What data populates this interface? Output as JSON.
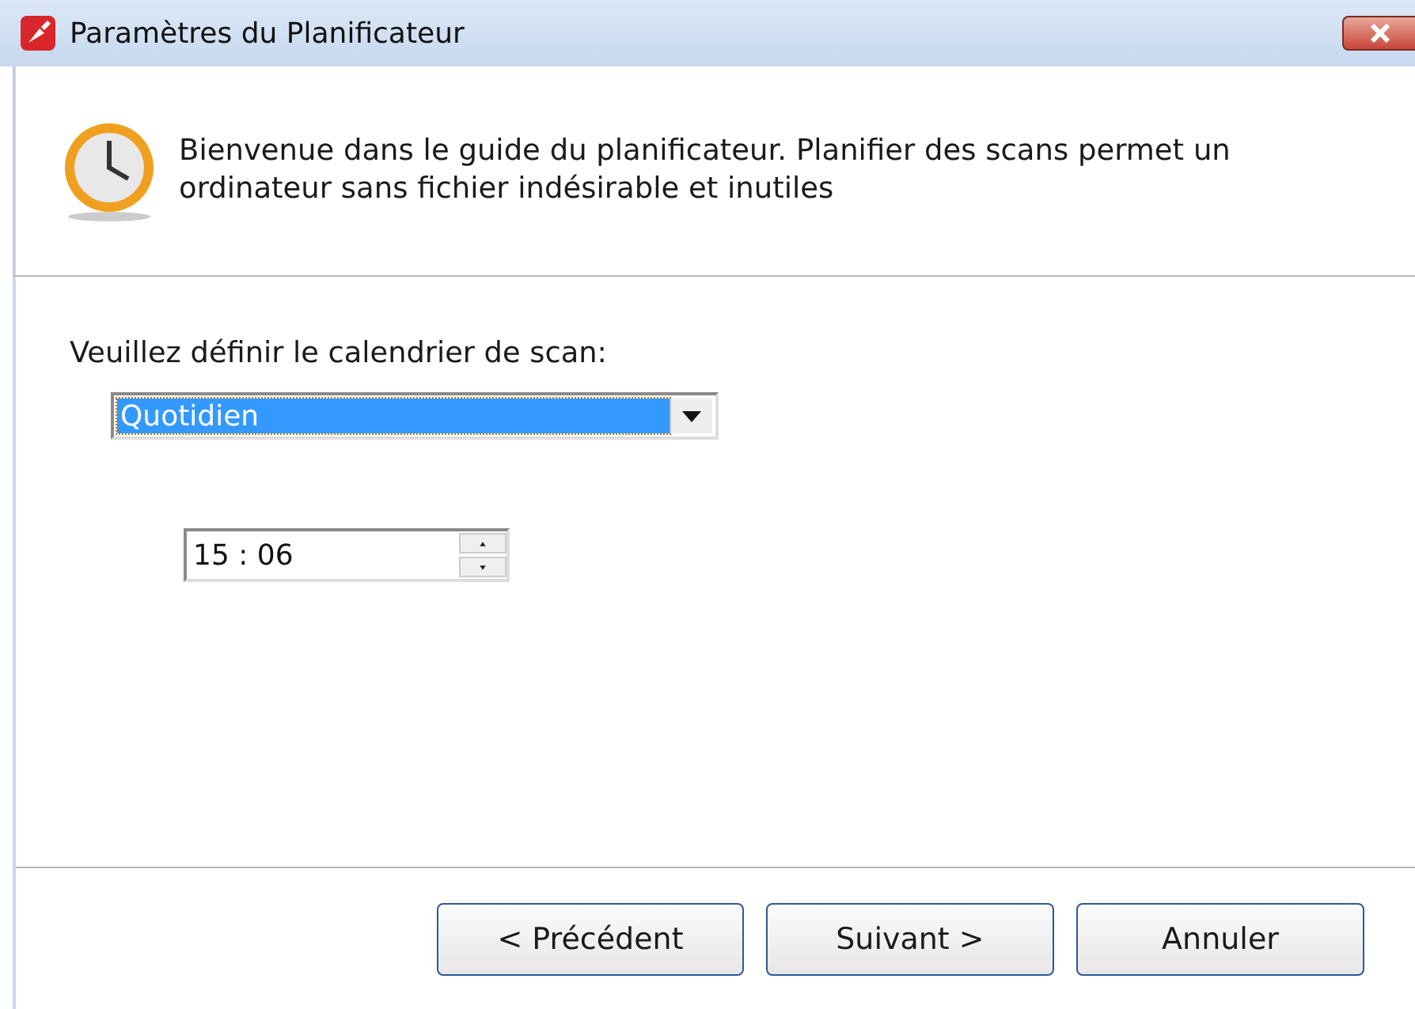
{
  "window": {
    "title": "Paramètres du Planificateur"
  },
  "header": {
    "message": "Bienvenue dans le guide du planificateur. Planifier des scans permet un ordinateur sans fichier indésirable et inutiles"
  },
  "schedule": {
    "label": "Veuillez définir le calendrier de scan:",
    "dropdown": {
      "value": "Quotidien",
      "highlighted": true
    },
    "time": {
      "value": "15 : 06"
    }
  },
  "buttons": [
    {
      "label": "< Précédent"
    },
    {
      "label": "Suivant >"
    },
    {
      "label": "Annuler"
    }
  ]
}
